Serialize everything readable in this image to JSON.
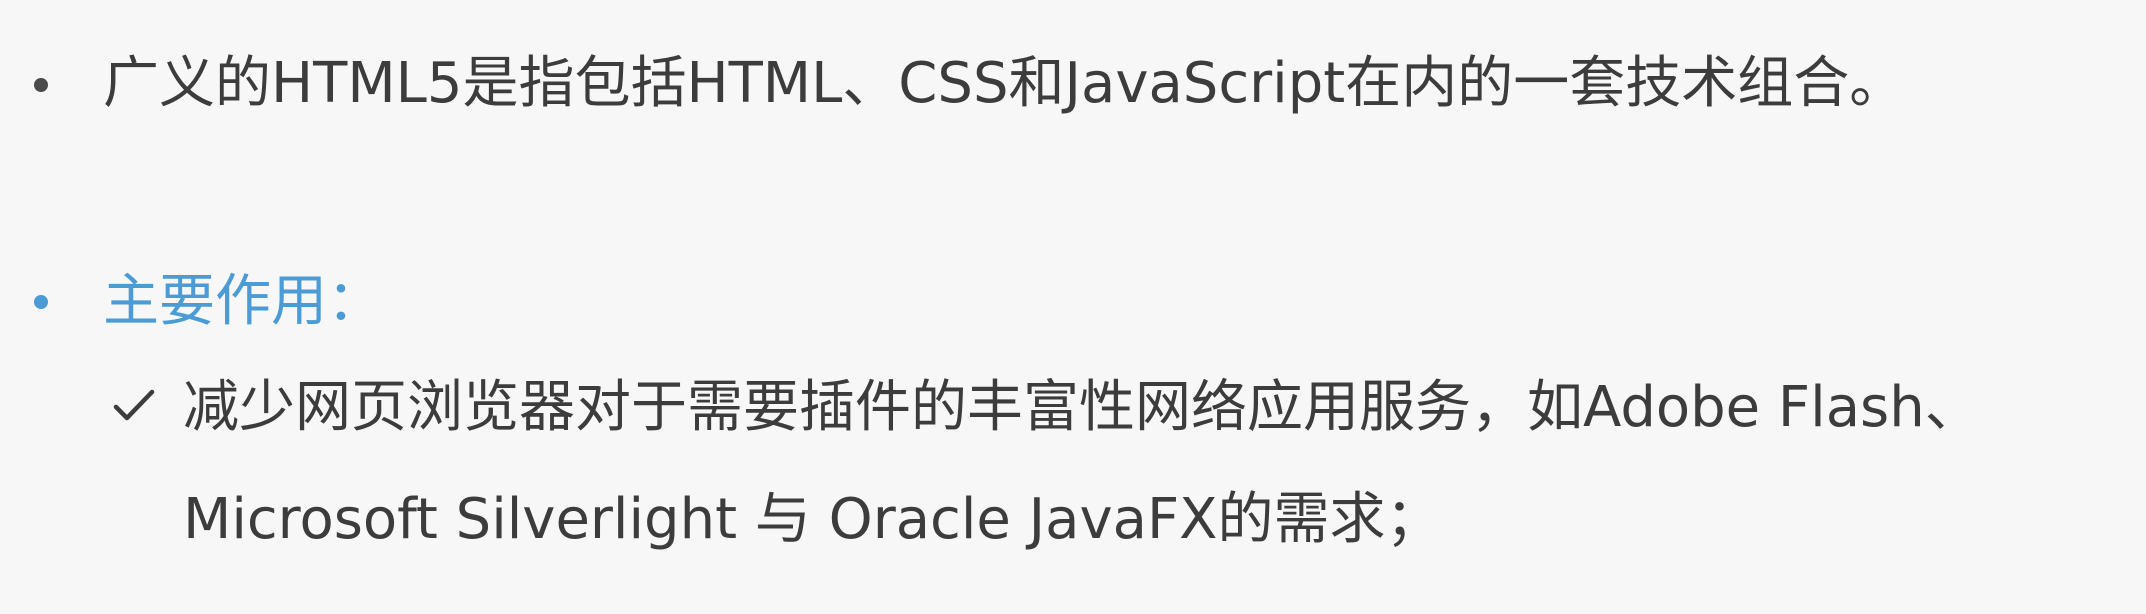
{
  "items": [
    {
      "bullet": "dot",
      "text": "广义的HTML5是指包括HTML、CSS和JavaScript在内的一套技术组合。"
    },
    {
      "bullet": "dot",
      "heading": "主要作用：",
      "subitems": [
        {
          "marker": "check-icon",
          "lines": [
            "减少网页浏览器对于需要插件的丰富性网络应用服务，如Adobe Flash、",
            "Microsoft Silverlight 与 Oracle JavaFX的需求；"
          ]
        }
      ]
    }
  ],
  "colors": {
    "text": "#3c3c3c",
    "accent": "#4a9bd6",
    "background": "#f7f7f7"
  }
}
